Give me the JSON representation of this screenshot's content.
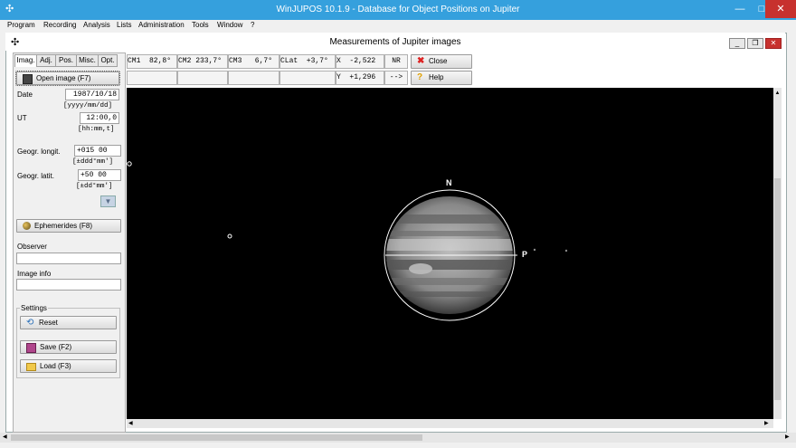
{
  "window": {
    "title": "WinJUPOS 10.1.9 - Database for Object Positions on Jupiter",
    "app_icon": "satellite-icon"
  },
  "menu": [
    "Program",
    "Recording",
    "Analysis",
    "Lists",
    "Administration",
    "Tools",
    "Window",
    "?"
  ],
  "child": {
    "title": "Measurements of Jupiter images"
  },
  "tabs": [
    "Imag.",
    "Adj.",
    "Pos.",
    "Misc.",
    "Opt."
  ],
  "left": {
    "open_image": "Open image (F7)",
    "date_label": "Date",
    "date_value": "1987/10/18",
    "date_fmt": "[yyyy/mm/dd]",
    "ut_label": "UT",
    "ut_value": "12:00,0",
    "ut_fmt": "[hh:mm,t]",
    "longit_label": "Geogr. longit.",
    "longit_value": "+015 00",
    "longit_fmt": "[±ddd°mm']",
    "latit_label": "Geogr. latit.",
    "latit_value": "+50 00",
    "latit_fmt": "[±dd°mm']",
    "ephemerides": "Ephemerides (F8)",
    "observer_label": "Observer",
    "observer_value": "",
    "image_info_label": "Image info",
    "image_info_value": "",
    "settings_label": "Settings",
    "reset": "Reset",
    "save": "Save (F2)",
    "load": "Load (F3)"
  },
  "readouts": {
    "cm1": "CM1  82,8°",
    "cm2": "CM2 233,7°",
    "cm3": "CM3   6,7°",
    "clat": "CLat  +3,7°",
    "x": "X  -2,522",
    "nr": "NR",
    "y": "Y  +1,296",
    "arrow": "-->",
    "close": "Close",
    "help": "Help"
  },
  "canvas": {
    "north_label": "N",
    "p_label": "P"
  },
  "colors": {
    "titlebar": "#35a0dd",
    "close_btn": "#c7312e",
    "canvas": "#000000"
  }
}
